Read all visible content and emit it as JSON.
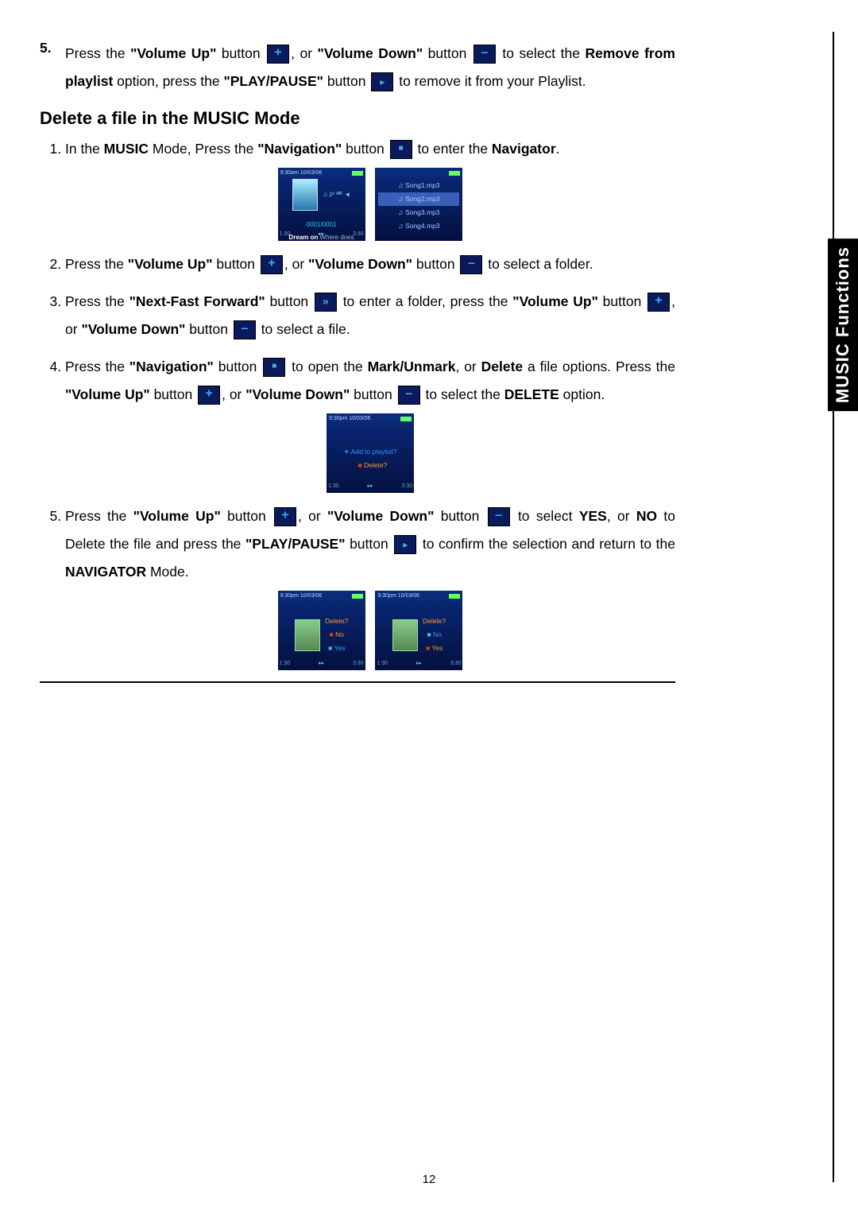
{
  "sideTab": "MUSIC Functions",
  "pageNumber": "12",
  "intro": {
    "num": "5.",
    "t1": "Press the ",
    "vu_lbl": "\"Volume Up\"",
    "t2": " button ",
    "t3": ", or ",
    "vd_lbl": "\"Volume Down\"",
    "t4": " button ",
    "t5": " to select the ",
    "remove_lbl": "Remove from playlist",
    "t6": " option, press the ",
    "pp_lbl": "\"PLAY/PAUSE\"",
    "t7": " button ",
    "t8": " to remove it from your Playlist."
  },
  "heading": "Delete a file in the MUSIC Mode",
  "s1": {
    "a": "In the ",
    "music": "MUSIC",
    "b": " Mode, Press the ",
    "nav_lbl": "\"Navigation\"",
    "c": " button ",
    "d": " to enter the ",
    "navigator": "Navigator",
    "e": "."
  },
  "s2": {
    "a": "Press the ",
    "vu": "\"Volume Up\"",
    "b": " button ",
    "c": ", or ",
    "vd": "\"Volume Down\"",
    "d": " button ",
    "e": " to select a folder."
  },
  "s3": {
    "a": "Press the ",
    "nff": "\"Next-Fast Forward\"",
    "b": " button ",
    "c": " to enter a folder, press the ",
    "vu": "\"Volume Up\"",
    "d": " button ",
    "e": ", or ",
    "vd": "\"Volume Down\"",
    "f": " button ",
    "g": " to select a file."
  },
  "s4": {
    "a": "Press the ",
    "nav": "\"Navigation\"",
    "b": " button ",
    "c": " to open the ",
    "mu": "Mark/Unmark",
    "d": ", or ",
    "del": "Delete",
    "e": " a file options. Press the ",
    "vu": "\"Volume Up\"",
    "f": " button ",
    "g": ", or ",
    "vd": "\"Volume Down\"",
    "h": " button ",
    "i": " to select the ",
    "DEL": "DELETE",
    "j": " option."
  },
  "s5": {
    "a": "Press the ",
    "vu": "\"Volume Up\"",
    "b": " button ",
    "c": ", or ",
    "vd": "\"Volume Down\"",
    "d": " button ",
    "e": " to select ",
    "yes": "YES",
    "f": ", or ",
    "no": "NO",
    "g": " to Delete the file and press the ",
    "pp": "\"PLAY/PAUSE\"",
    "h": " button ",
    "i": " to confirm the selection and return to the ",
    "navm": "NAVIGATOR",
    "j": " Mode."
  },
  "screen1": {
    "time": "9:30am  10/03/06",
    "songs": [
      "Song1.mp3",
      "Song2.mp3",
      "Song3.mp3",
      "Song4.mp3"
    ],
    "counter": "0001/0001",
    "now_b": "Dream on",
    "now": " Where does",
    "f1": "1:30",
    "f2": "▸▸",
    "f3": "3:30"
  },
  "screen2": {
    "time": "9:30pm   10/03/06",
    "opt1": "Add to playlist?",
    "opt2": "Delete?",
    "f1": "1:30",
    "f2": "▸▸",
    "f3": "3:30"
  },
  "screen3": {
    "time": "9:30pm   10/03/06",
    "title": "Delete?",
    "no": "No",
    "yes": "Yes",
    "f1": "1:30",
    "f2": "▸▸",
    "f3": "3:30"
  }
}
